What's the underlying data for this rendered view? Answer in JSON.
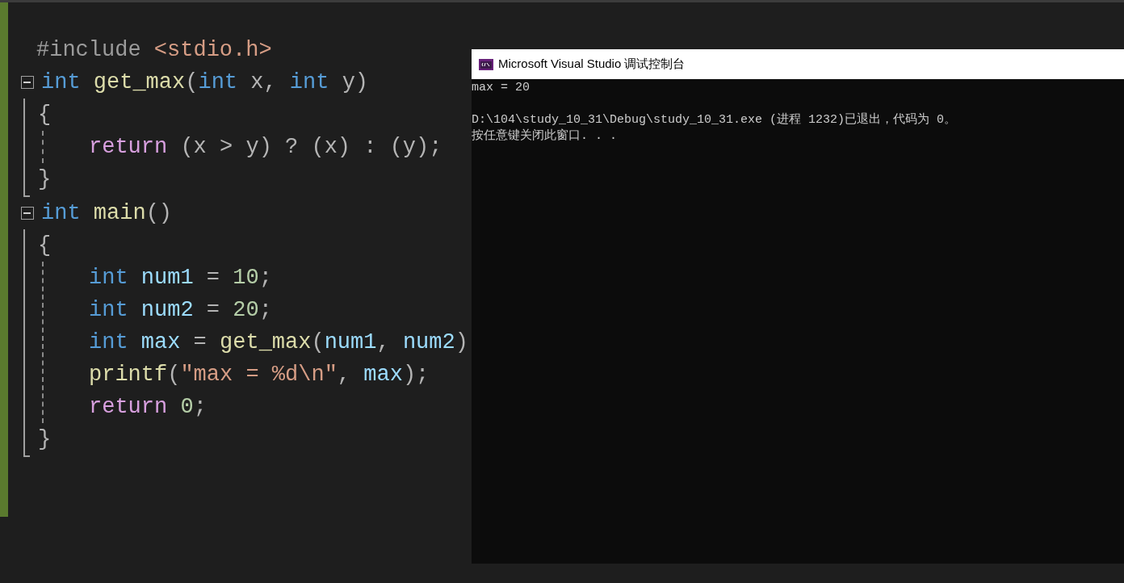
{
  "editor": {
    "items": [
      {
        "kind": "line",
        "tokens": [
          {
            "text": "#include ",
            "kind": "pre"
          },
          {
            "text": "<stdio.h>",
            "kind": "str"
          }
        ]
      },
      {
        "kind": "function",
        "expanded": true,
        "header": [
          {
            "text": "int ",
            "kind": "kw"
          },
          {
            "text": "get_max",
            "kind": "fn"
          },
          {
            "text": "(",
            "kind": "p"
          },
          {
            "text": "int",
            "kind": "kw"
          },
          {
            "text": " x, ",
            "kind": "p"
          },
          {
            "text": "int",
            "kind": "kw"
          },
          {
            "text": " y)",
            "kind": "p"
          }
        ],
        "children": [
          {
            "kind": "line",
            "tokens": [
              {
                "text": "{",
                "kind": "p"
              }
            ]
          },
          {
            "kind": "block",
            "children": [
              {
                "kind": "line",
                "tokens": [
                  {
                    "text": "return",
                    "kind": "ctl"
                  },
                  {
                    "text": " (x > y) ? (x) : (y);",
                    "kind": "p"
                  }
                ]
              }
            ]
          },
          {
            "kind": "line",
            "tokens": [
              {
                "text": "}",
                "kind": "p"
              }
            ]
          }
        ]
      },
      {
        "kind": "function",
        "expanded": true,
        "header": [
          {
            "text": "int ",
            "kind": "kw"
          },
          {
            "text": "main",
            "kind": "fn"
          },
          {
            "text": "()",
            "kind": "p"
          }
        ],
        "children": [
          {
            "kind": "line",
            "tokens": [
              {
                "text": "{",
                "kind": "p"
              }
            ]
          },
          {
            "kind": "block",
            "children": [
              {
                "kind": "line",
                "tokens": [
                  {
                    "text": "int ",
                    "kind": "kw"
                  },
                  {
                    "text": "num1",
                    "kind": "var"
                  },
                  {
                    "text": " = ",
                    "kind": "p"
                  },
                  {
                    "text": "10",
                    "kind": "num"
                  },
                  {
                    "text": ";",
                    "kind": "p"
                  }
                ]
              },
              {
                "kind": "line",
                "tokens": [
                  {
                    "text": "int ",
                    "kind": "kw"
                  },
                  {
                    "text": "num2",
                    "kind": "var"
                  },
                  {
                    "text": " = ",
                    "kind": "p"
                  },
                  {
                    "text": "20",
                    "kind": "num"
                  },
                  {
                    "text": ";",
                    "kind": "p"
                  }
                ]
              },
              {
                "kind": "line",
                "tokens": [
                  {
                    "text": "int ",
                    "kind": "kw"
                  },
                  {
                    "text": "max",
                    "kind": "var"
                  },
                  {
                    "text": " = ",
                    "kind": "p"
                  },
                  {
                    "text": "get_max",
                    "kind": "fn"
                  },
                  {
                    "text": "(",
                    "kind": "p"
                  },
                  {
                    "text": "num1",
                    "kind": "var"
                  },
                  {
                    "text": ", ",
                    "kind": "p"
                  },
                  {
                    "text": "num2",
                    "kind": "var"
                  },
                  {
                    "text": ")",
                    "kind": "p"
                  }
                ]
              },
              {
                "kind": "line",
                "tokens": [
                  {
                    "text": "printf",
                    "kind": "fn"
                  },
                  {
                    "text": "(",
                    "kind": "p"
                  },
                  {
                    "text": "\"max = %d\\n\"",
                    "kind": "str"
                  },
                  {
                    "text": ", ",
                    "kind": "p"
                  },
                  {
                    "text": "max",
                    "kind": "var"
                  },
                  {
                    "text": ");",
                    "kind": "p"
                  }
                ]
              },
              {
                "kind": "line",
                "tokens": [
                  {
                    "text": "return ",
                    "kind": "ctl"
                  },
                  {
                    "text": "0",
                    "kind": "num"
                  },
                  {
                    "text": ";",
                    "kind": "p"
                  }
                ]
              }
            ]
          },
          {
            "kind": "line",
            "tokens": [
              {
                "text": "}",
                "kind": "p"
              }
            ]
          }
        ]
      }
    ]
  },
  "console": {
    "title": "Microsoft Visual Studio 调试控制台",
    "output": [
      "max = 20"
    ],
    "exit_message": [
      "D:\\104\\study_10_31\\Debug\\study_10_31.exe (进程 1232)已退出，代码为 0。",
      "按任意键关闭此窗口. . ."
    ]
  }
}
